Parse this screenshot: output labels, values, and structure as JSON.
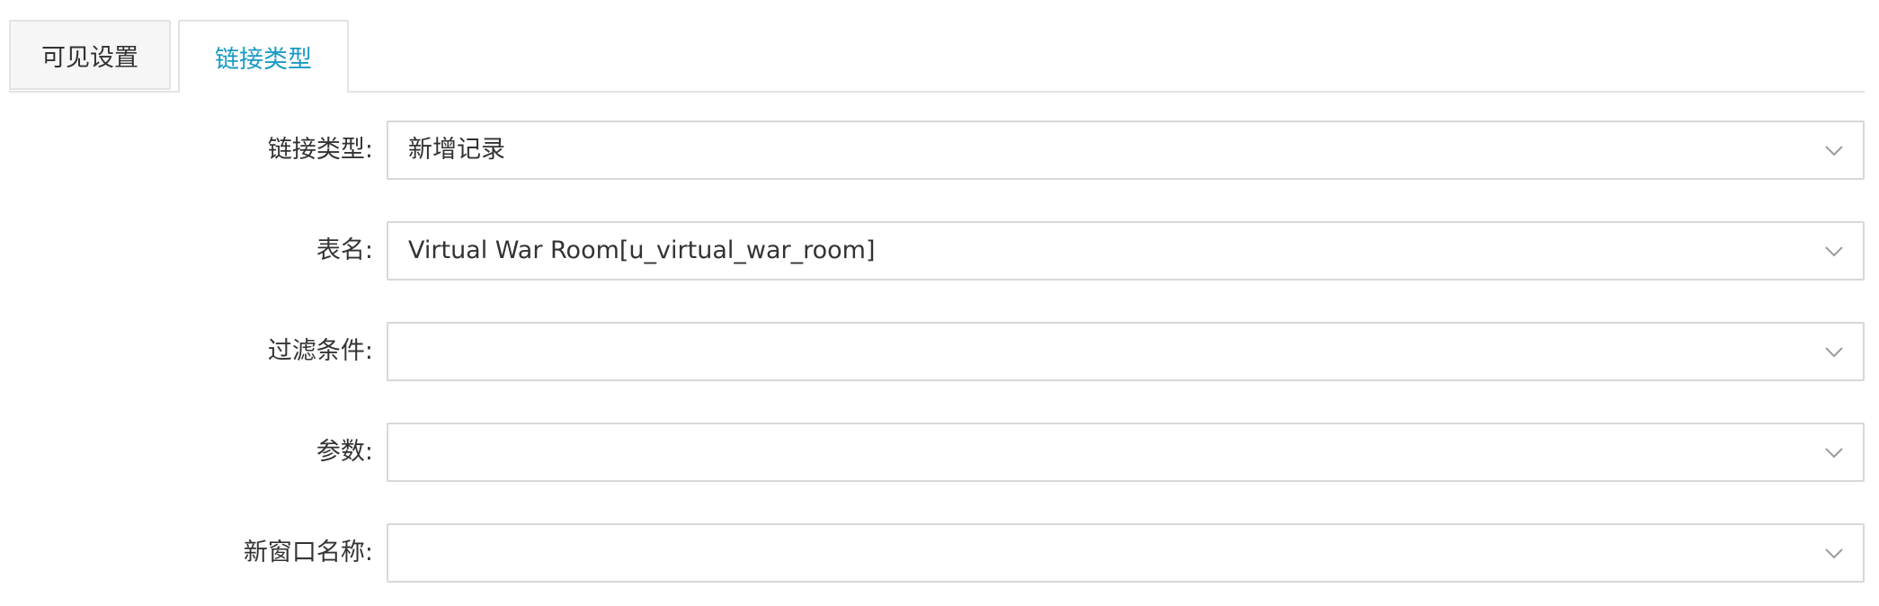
{
  "tabs": [
    {
      "label": "可见设置",
      "active": false
    },
    {
      "label": "链接类型",
      "active": true
    }
  ],
  "form": {
    "link_type": {
      "label": "链接类型:",
      "value": "新增记录"
    },
    "table_name": {
      "label": "表名:",
      "value": "Virtual War Room[u_virtual_war_room]"
    },
    "filter": {
      "label": "过滤条件:",
      "value": ""
    },
    "params": {
      "label": "参数:",
      "value": ""
    },
    "window_name": {
      "label": "新窗口名称:",
      "value": ""
    }
  },
  "icons": {
    "select_arrow": "chevron-down-icon"
  },
  "colors": {
    "active_tab": "#1a9bc4",
    "border": "#d8d8d8",
    "inactive_tab_bg": "#f6f6f6",
    "text": "#333333"
  }
}
